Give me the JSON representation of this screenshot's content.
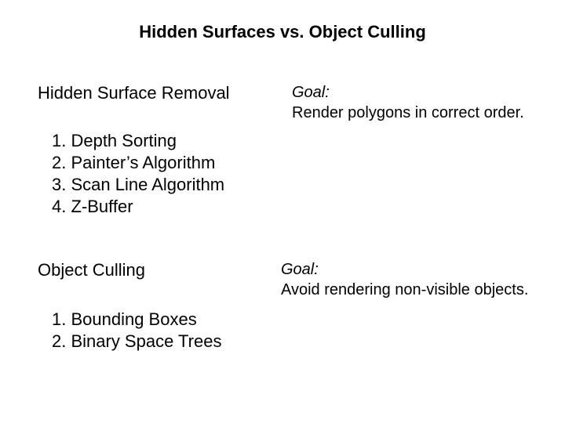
{
  "title": "Hidden Surfaces vs. Object Culling",
  "section1": {
    "heading": "Hidden Surface Removal",
    "items": {
      "i1": "1. Depth Sorting",
      "i2": "2. Painter’s Algorithm",
      "i3": "3. Scan Line Algorithm",
      "i4": "4. Z-Buffer"
    },
    "goal_label": "Goal:",
    "goal_text": "Render polygons in correct order."
  },
  "section2": {
    "heading": "Object Culling",
    "items": {
      "i1": "1. Bounding Boxes",
      "i2": "2. Binary Space Trees"
    },
    "goal_label": "Goal:",
    "goal_text": "Avoid rendering non-visible objects."
  }
}
